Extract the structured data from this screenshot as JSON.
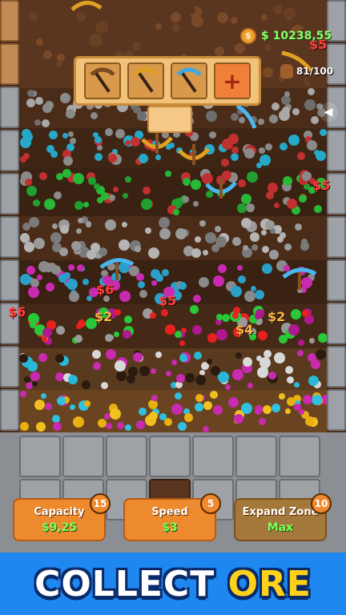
{
  "hud": {
    "money": "$ 10238,55",
    "coin_icon": "coin-icon",
    "capacity_counter": "81/100",
    "sound_icon": "speaker-icon"
  },
  "tools": {
    "slots": [
      {
        "icon": "pickaxe-brown-icon",
        "color": "#7a4a20"
      },
      {
        "icon": "pickaxe-gold-icon",
        "color": "#e0a020"
      },
      {
        "icon": "pickaxe-blue-icon",
        "color": "#40a8e0"
      }
    ],
    "add_label": "+"
  },
  "prices": {
    "p1": "$5",
    "p2": "$6",
    "p3": "$6",
    "p4": "$2",
    "p5": "$5",
    "p6": "$4",
    "p7": "$2",
    "p8": "$5"
  },
  "upgrades": [
    {
      "label": "Capacity",
      "value": "$9,25",
      "level": "15"
    },
    {
      "label": "Speed",
      "value": "$3",
      "level": "5"
    },
    {
      "label": "Expand Zone",
      "value": "Max",
      "level": "10"
    }
  ],
  "banner": {
    "word1": "COLLECT",
    "word2": "ORE"
  },
  "colors": {
    "money_green": "#8bff6a",
    "banner_blue": "#1f88f0",
    "banner_yellow": "#ffd21a",
    "upgrade_orange": "#ee8a2e"
  }
}
